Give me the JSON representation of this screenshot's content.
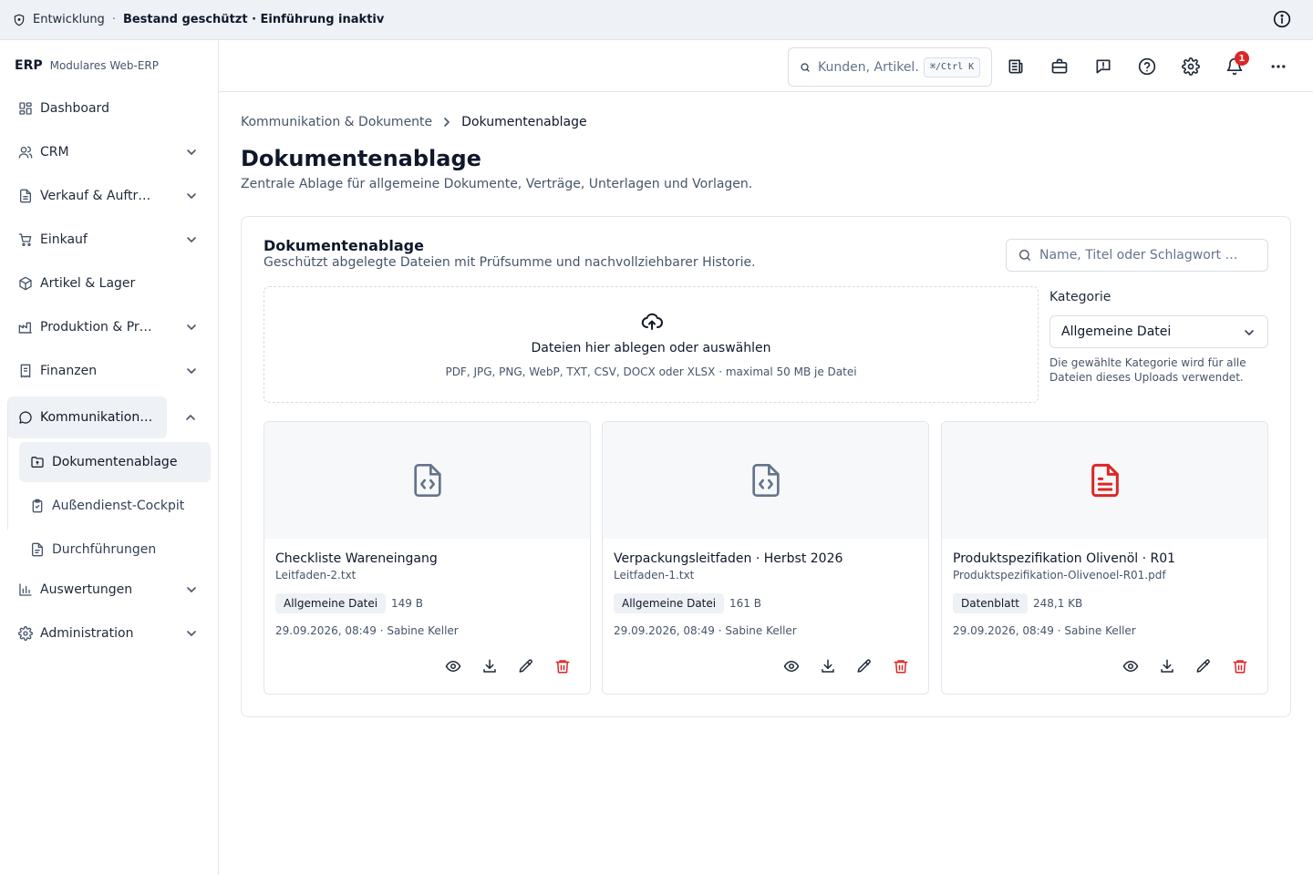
{
  "banner": {
    "environment": "Entwicklung",
    "separator": "·",
    "status": "Bestand geschützt · Einführung inaktiv"
  },
  "brand": {
    "logo": "ERP",
    "tagline": "Modulares Web-ERP"
  },
  "sidebar": {
    "items": [
      {
        "label": "Dashboard",
        "icon": "dashboard-icon"
      },
      {
        "label": "CRM",
        "icon": "users-icon"
      },
      {
        "label": "Verkauf & Auftr…",
        "icon": "document-icon"
      },
      {
        "label": "Einkauf",
        "icon": "cart-icon"
      },
      {
        "label": "Artikel & Lager",
        "icon": "package-icon"
      },
      {
        "label": "Produktion & Pr…",
        "icon": "factory-icon"
      },
      {
        "label": "Finanzen",
        "icon": "receipt-icon"
      },
      {
        "label": "Kommunikation…",
        "icon": "chat-icon"
      },
      {
        "label": "Auswertungen",
        "icon": "bar-chart-icon"
      },
      {
        "label": "Administration",
        "icon": "gear-icon"
      }
    ],
    "sub_items": [
      {
        "label": "Dokumentenablage",
        "icon": "folder-icon"
      },
      {
        "label": "Außendienst-Cockpit",
        "icon": "clipboard-icon"
      },
      {
        "label": "Durchführungen",
        "icon": "file-text-icon"
      }
    ]
  },
  "header": {
    "search_placeholder": "Kunden, Artikel…",
    "shortcut": "⌘/Ctrl K",
    "notification_count": "1"
  },
  "breadcrumb": {
    "parent": "Kommunikation & Dokumente",
    "current": "Dokumentenablage"
  },
  "page": {
    "title": "Dokumentenablage",
    "subtitle": "Zentrale Ablage für allgemeine Dokumente, Verträge, Unterlagen und Vorlagen."
  },
  "panel": {
    "title": "Dokumentenablage",
    "subtitle": "Geschützt abgelegte Dateien mit Prüfsumme und nachvollziehbarer Historie.",
    "search_placeholder": "Name, Titel oder Schlagwort …"
  },
  "dropzone": {
    "title": "Dateien hier ablegen oder auswählen",
    "hint": "PDF, JPG, PNG, WebP, TXT, CSV, DOCX oder XLSX · maximal 50 MB je Datei"
  },
  "category": {
    "label": "Kategorie",
    "selected": "Allgemeine Datei",
    "hint": "Die gewählte Kategorie wird für alle Dateien dieses Uploads verwendet."
  },
  "documents": [
    {
      "title": "Checkliste Wareneingang",
      "filename": "Leitfaden-2.txt",
      "category": "Allgemeine Datei",
      "size": "149 B",
      "meta": "29.09.2026, 08:49 · Sabine Keller",
      "icon": "file-code-icon",
      "icon_color": "#64748b"
    },
    {
      "title": "Verpackungsleitfaden · Herbst 2026",
      "filename": "Leitfaden-1.txt",
      "category": "Allgemeine Datei",
      "size": "161 B",
      "meta": "29.09.2026, 08:49 · Sabine Keller",
      "icon": "file-code-icon",
      "icon_color": "#64748b"
    },
    {
      "title": "Produktspezifikation Olivenöl · R01",
      "filename": "Produktspezifikation-Olivenoel-R01.pdf",
      "category": "Datenblatt",
      "size": "248,1 KB",
      "meta": "29.09.2026, 08:49 · Sabine Keller",
      "icon": "file-pdf-icon",
      "icon_color": "#dc2626"
    }
  ],
  "colors": {
    "danger": "#dc2626",
    "muted": "#475569",
    "active_bg": "#eef1f5"
  }
}
